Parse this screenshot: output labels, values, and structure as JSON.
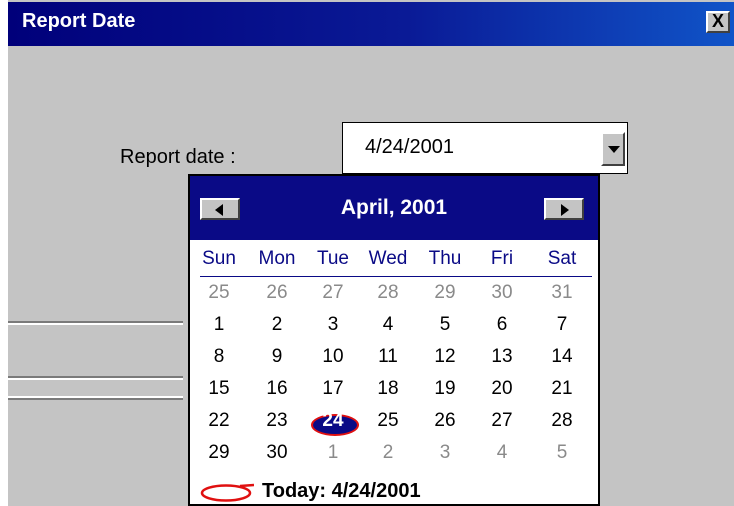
{
  "window": {
    "title": "Report Date",
    "close_label": "X"
  },
  "form": {
    "report_date_label": "Report date :",
    "report_date_value": "4/24/2001"
  },
  "calendar": {
    "month_title": "April, 2001",
    "weekdays": [
      "Sun",
      "Mon",
      "Tue",
      "Wed",
      "Thu",
      "Fri",
      "Sat"
    ],
    "weeks": [
      [
        "25",
        "26",
        "27",
        "28",
        "29",
        "30",
        "31"
      ],
      [
        "1",
        "2",
        "3",
        "4",
        "5",
        "6",
        "7"
      ],
      [
        "8",
        "9",
        "10",
        "11",
        "12",
        "13",
        "14"
      ],
      [
        "15",
        "16",
        "17",
        "18",
        "19",
        "20",
        "21"
      ],
      [
        "22",
        "23",
        "24",
        "25",
        "26",
        "27",
        "28"
      ],
      [
        "29",
        "30",
        "1",
        "2",
        "3",
        "4",
        "5"
      ]
    ],
    "other_month": [
      [
        true,
        true,
        true,
        true,
        true,
        true,
        true
      ],
      [
        false,
        false,
        false,
        false,
        false,
        false,
        false
      ],
      [
        false,
        false,
        false,
        false,
        false,
        false,
        false
      ],
      [
        false,
        false,
        false,
        false,
        false,
        false,
        false
      ],
      [
        false,
        false,
        false,
        false,
        false,
        false,
        false
      ],
      [
        false,
        false,
        true,
        true,
        true,
        true,
        true
      ]
    ],
    "selected": {
      "week": 4,
      "day": 2
    },
    "today_label": "Today: 4/24/2001"
  },
  "colors": {
    "header_blue": "#0a0a86",
    "title_gradient_start": "#00007a",
    "title_gradient_end": "#1054c8",
    "circle_red": "#e01010"
  },
  "icons": {
    "prev": "triangle-left-icon",
    "next": "triangle-right-icon",
    "dropdown": "triangle-down-icon"
  }
}
